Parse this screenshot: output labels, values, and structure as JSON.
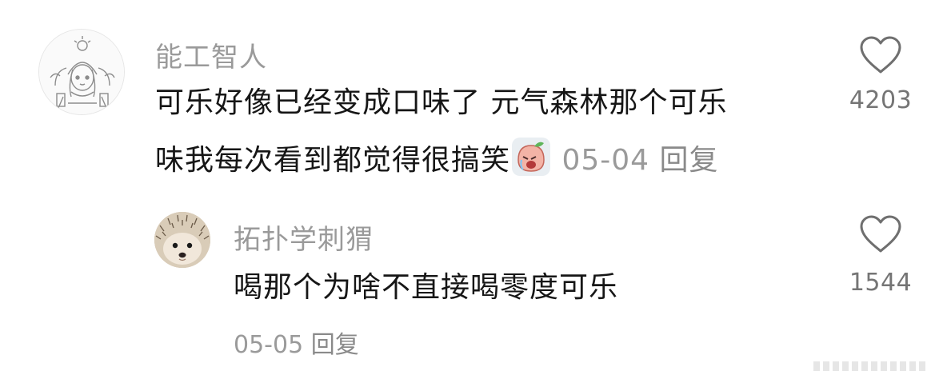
{
  "comments": [
    {
      "username": "能工智人",
      "text_line1": "可乐好像已经变成口味了 元气森林那个可乐",
      "text_line2": "味我每次看到都觉得很搞笑",
      "emoji_icon": "crying-peach-emoji",
      "date": "05-04",
      "reply_label": "回复",
      "likes": "4203"
    },
    {
      "username": "拓扑学刺猬",
      "text": "喝那个为啥不直接喝零度可乐",
      "date": "05-05",
      "reply_label": "回复",
      "likes": "1544"
    }
  ],
  "colors": {
    "username": "#9a9a9a",
    "text": "#161616",
    "like_count": "#757575"
  }
}
